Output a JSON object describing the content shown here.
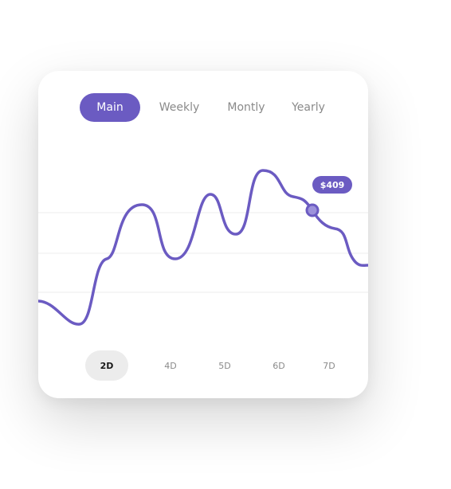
{
  "tabs": [
    {
      "label": "Main",
      "active": true
    },
    {
      "label": "Weekly",
      "active": false
    },
    {
      "label": "Montly",
      "active": false
    },
    {
      "label": "Yearly",
      "active": false
    }
  ],
  "tooltip": {
    "value": "$409"
  },
  "periods": [
    {
      "label": "2D",
      "active": true
    },
    {
      "label": "4D",
      "active": false
    },
    {
      "label": "5D",
      "active": false
    },
    {
      "label": "6D",
      "active": false
    },
    {
      "label": "7D",
      "active": false
    }
  ],
  "colors": {
    "accent": "#6b5bc2",
    "marker_fill": "#9d92db",
    "grid": "#eeeeee",
    "tab_inactive_text": "#8a8a8a",
    "period_active_bg": "#ececec"
  }
}
